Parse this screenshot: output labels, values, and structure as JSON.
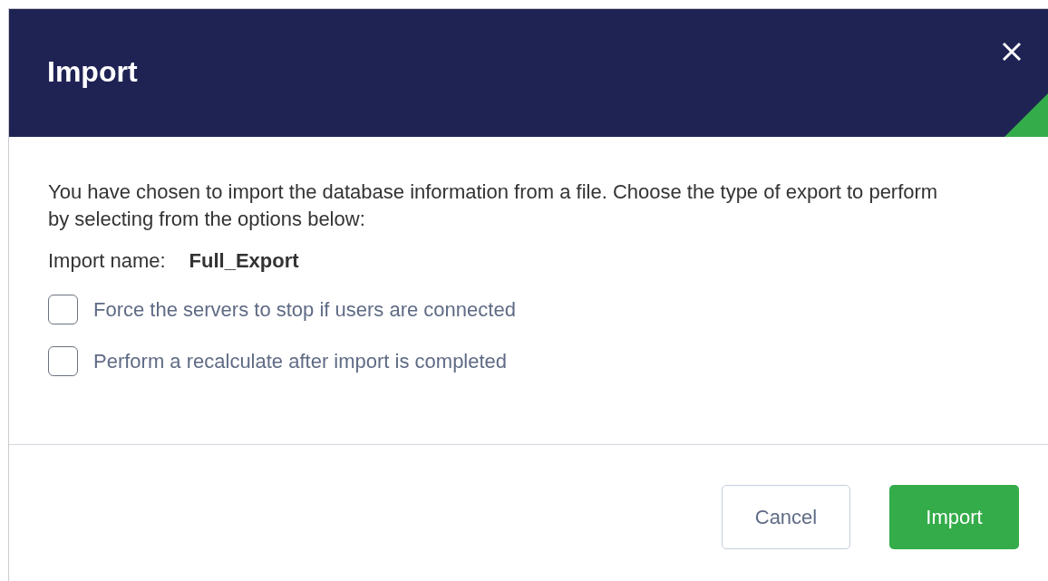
{
  "dialog": {
    "title": "Import"
  },
  "intro": "You have chosen to import the database information from a file.  Choose the type of export to perform by selecting from the options below:",
  "import_name": {
    "label": "Import name:",
    "value": "Full_Export"
  },
  "options": [
    {
      "label": "Force the servers to stop if users are connected",
      "checked": false
    },
    {
      "label": "Perform a recalculate after import is completed",
      "checked": false
    }
  ],
  "buttons": [
    {
      "label": "Cancel",
      "kind": "secondary"
    },
    {
      "label": "Import",
      "kind": "primary"
    }
  ]
}
